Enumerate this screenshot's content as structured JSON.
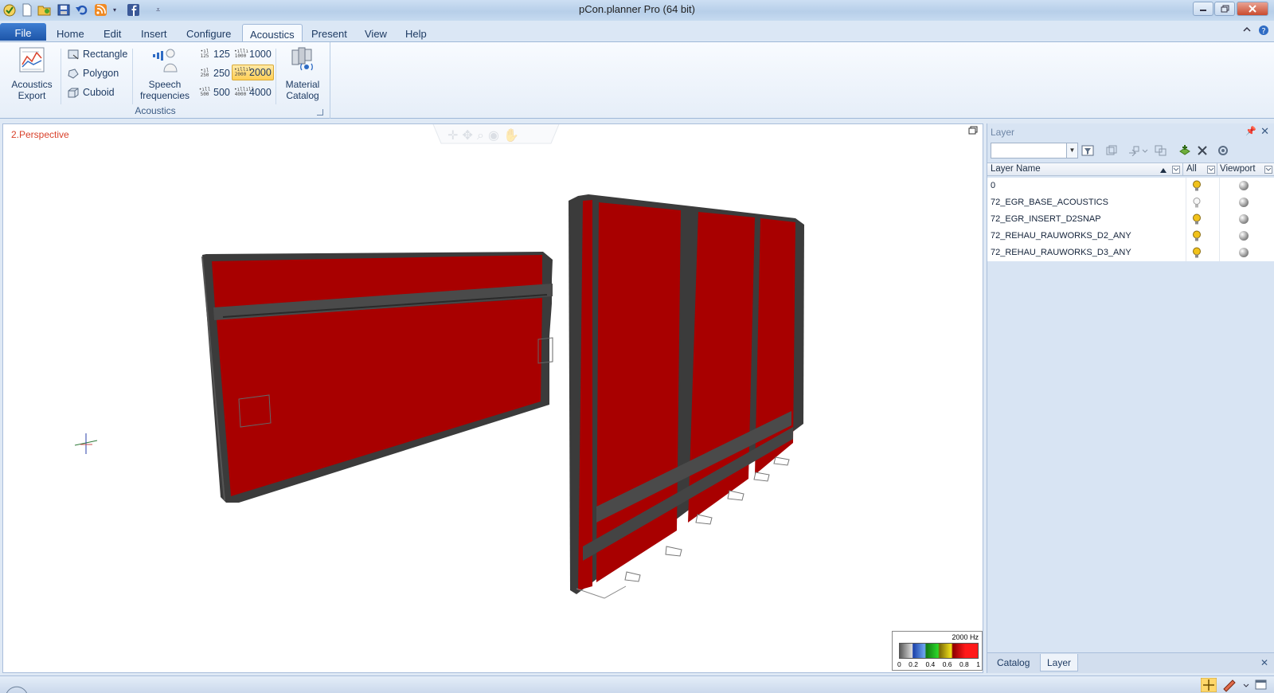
{
  "window": {
    "title": "pCon.planner Pro (64 bit)"
  },
  "quick_access": [
    "check-icon",
    "new-file-icon",
    "open-folder-icon",
    "save-icon",
    "undo-icon",
    "rss-icon",
    "facebook-icon",
    "customize-icon"
  ],
  "tabs": [
    {
      "label": "File"
    },
    {
      "label": "Home"
    },
    {
      "label": "Edit"
    },
    {
      "label": "Insert"
    },
    {
      "label": "Configure"
    },
    {
      "label": "Acoustics"
    },
    {
      "label": "Present"
    },
    {
      "label": "View"
    },
    {
      "label": "Help"
    }
  ],
  "active_tab": "Acoustics",
  "ribbon": {
    "acoustics_export": {
      "line1": "Acoustics",
      "line2": "Export"
    },
    "shapes": [
      {
        "label": "Rectangle",
        "icon": "rectangle-icon"
      },
      {
        "label": "Polygon",
        "icon": "polygon-icon"
      },
      {
        "label": "Cuboid",
        "icon": "cuboid-icon"
      }
    ],
    "speech": {
      "line1": "Speech",
      "line2": "frequencies"
    },
    "frequencies": [
      {
        "label": "125",
        "icon_text": "125"
      },
      {
        "label": "250",
        "icon_text": "250"
      },
      {
        "label": "500",
        "icon_text": "500"
      },
      {
        "label": "1000",
        "icon_text": "1000"
      },
      {
        "label": "2000",
        "icon_text": "2000",
        "active": true
      },
      {
        "label": "4000",
        "icon_text": "4000"
      }
    ],
    "material_catalog": {
      "line1": "Material",
      "line2": "Catalog"
    },
    "group_label": "Acoustics"
  },
  "viewport": {
    "label": "2.Perspective"
  },
  "legend": {
    "title": "2000 Hz",
    "ticks": [
      "0",
      "0.2",
      "0.4",
      "0.6",
      "0.8",
      "1"
    ]
  },
  "layer_panel": {
    "title": "Layer",
    "search_value": "",
    "columns": {
      "name": "Layer Name",
      "all": "All",
      "viewport": "Viewport"
    },
    "rows": [
      {
        "name": "0",
        "visible_all": true
      },
      {
        "name": "72_EGR_BASE_ACOUSTICS",
        "visible_all": false
      },
      {
        "name": "72_EGR_INSERT_D2SNAP",
        "visible_all": true
      },
      {
        "name": "72_REHAU_RAUWORKS_D2_ANY",
        "visible_all": true
      },
      {
        "name": "72_REHAU_RAUWORKS_D3_ANY",
        "visible_all": true
      }
    ],
    "bottom_tabs": [
      {
        "label": "Catalog"
      },
      {
        "label": "Layer"
      }
    ],
    "active_bottom_tab": "Layer"
  },
  "colors": {
    "panel_red": "#a80000",
    "frame_gray": "#3c3c3c",
    "accent_blue": "#1d55a8",
    "bulb_yellow": "#f1c21b"
  }
}
